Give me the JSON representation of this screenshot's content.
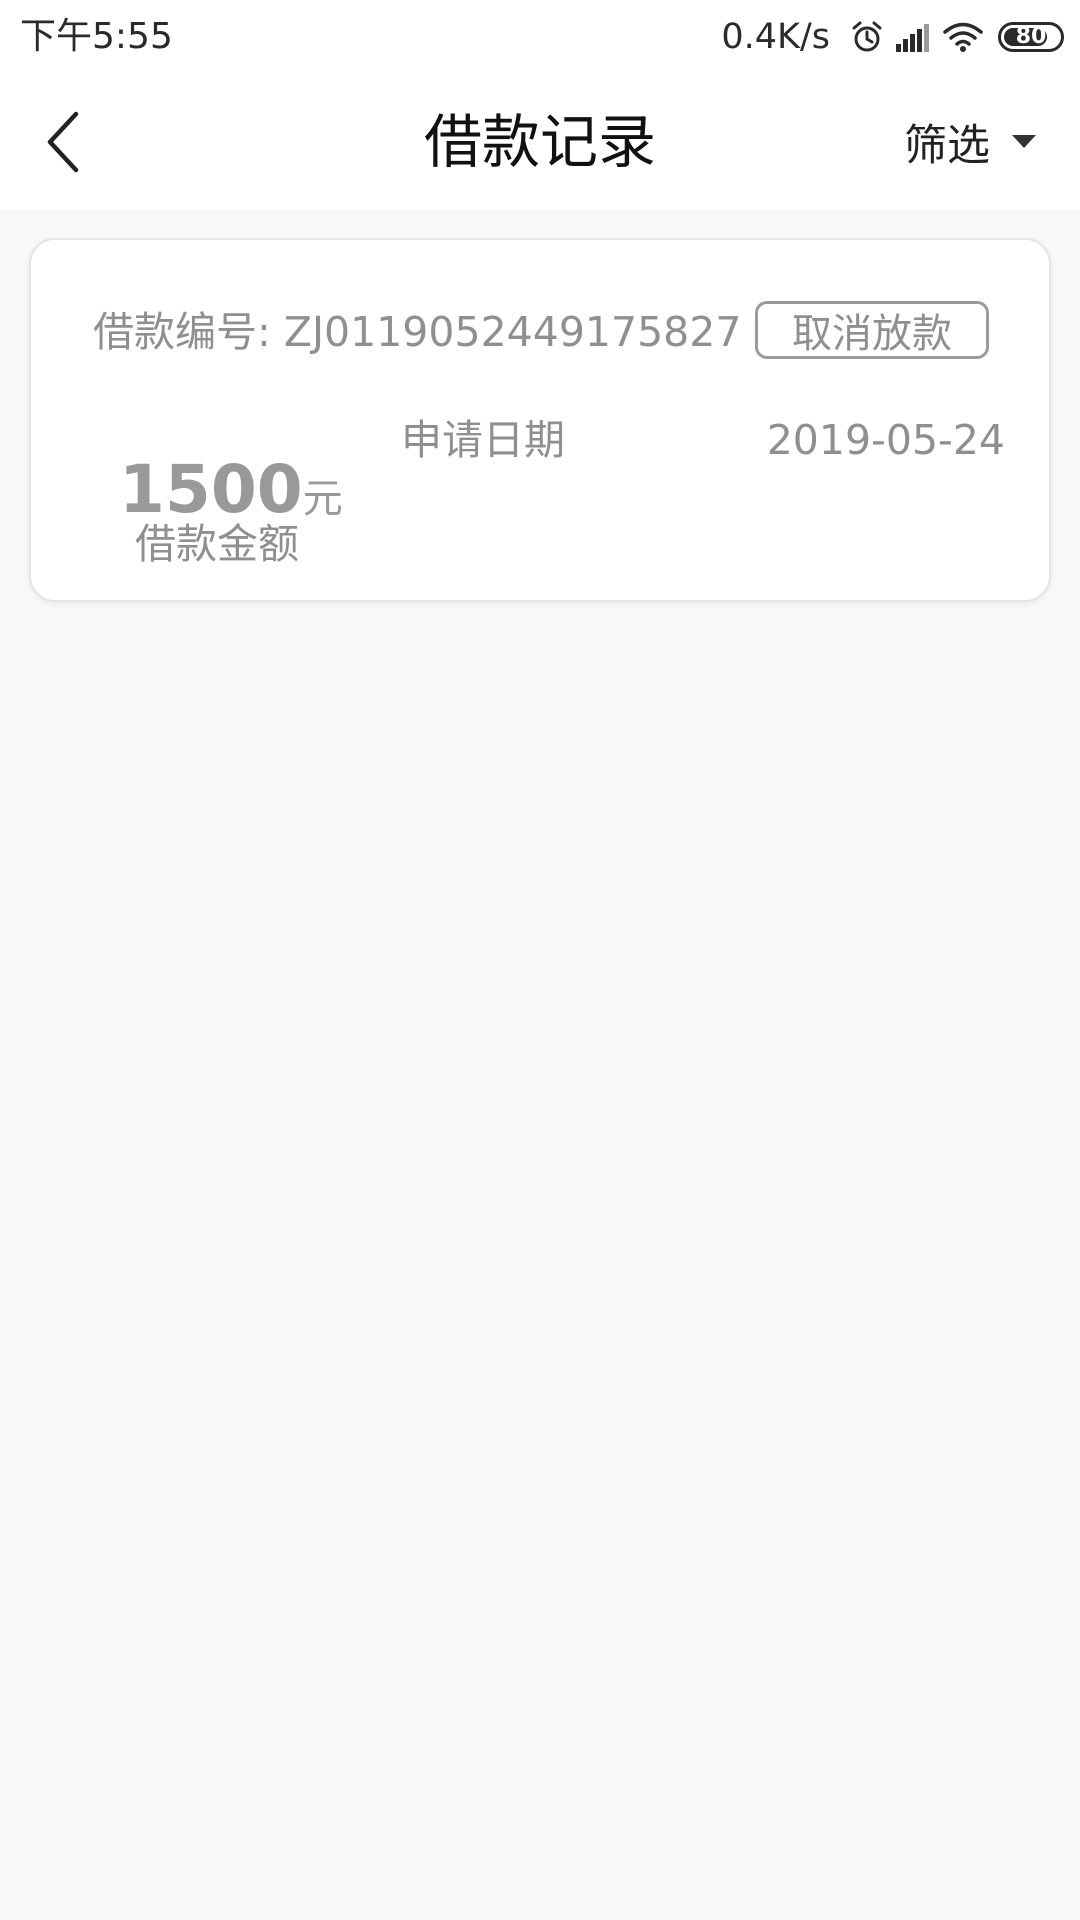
{
  "status_bar": {
    "time": "下午5:55",
    "net_speed": "0.4K/s",
    "battery_level": "80",
    "battery_fraction": 0.8,
    "icons": [
      "alarm-icon",
      "signal-icon",
      "wifi-icon",
      "battery-icon"
    ]
  },
  "header": {
    "title": "借款记录",
    "filter_label": "筛选",
    "back_icon": "chevron-left-icon",
    "filter_icon": "caret-down-icon"
  },
  "records": [
    {
      "loan_number_label": "借款编号:",
      "loan_number": "ZJ0119052449175827",
      "action_label": "取消放款",
      "amount": "1500",
      "amount_unit": "元",
      "amount_label": "借款金额",
      "date_label": "申请日期",
      "date": "2019-05-24"
    }
  ],
  "colors": {
    "background": "#f8f8f8",
    "card": "#ffffff",
    "muted_text": "#8f8f8f",
    "title_text": "#111111"
  }
}
